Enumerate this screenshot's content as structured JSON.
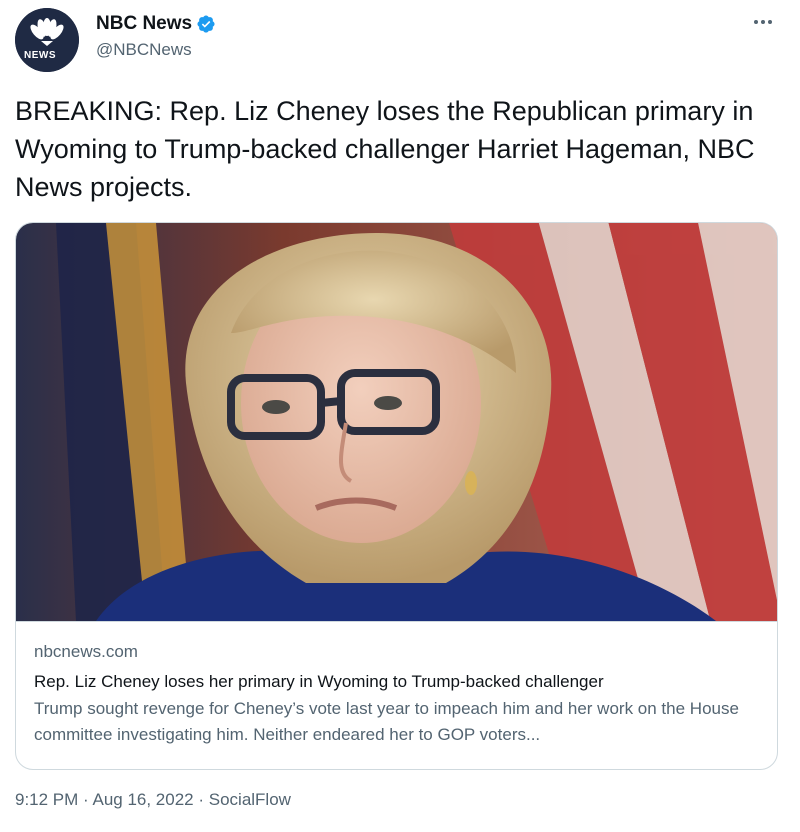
{
  "author": {
    "display_name": "NBC News",
    "handle": "@NBCNews",
    "avatar_tag": "NEWS",
    "verified": true
  },
  "tweet": {
    "text": "BREAKING: Rep. Liz Cheney loses the Republican primary in Wyoming to Trump-backed challenger Harriet Hageman, NBC News projects."
  },
  "card": {
    "domain": "nbcnews.com",
    "title": "Rep. Liz Cheney loses her primary in Wyoming to Trump-backed challenger",
    "description": "Trump sought revenge for Cheney’s vote last year to impeach him and her work on the House committee investigating him. Neither endeared her to GOP voters..."
  },
  "meta": {
    "time": "9:12 PM",
    "sep1": " · ",
    "date": "Aug 16, 2022",
    "sep2": " · ",
    "source": "SocialFlow"
  },
  "colors": {
    "text_primary": "#0f1419",
    "text_secondary": "#536471",
    "verified_blue": "#1d9bf0",
    "border": "#cfd9de"
  },
  "icons": {
    "verified": "verified-badge-icon",
    "more": "more-options-icon",
    "logo": "nbc-peacock-logo"
  }
}
